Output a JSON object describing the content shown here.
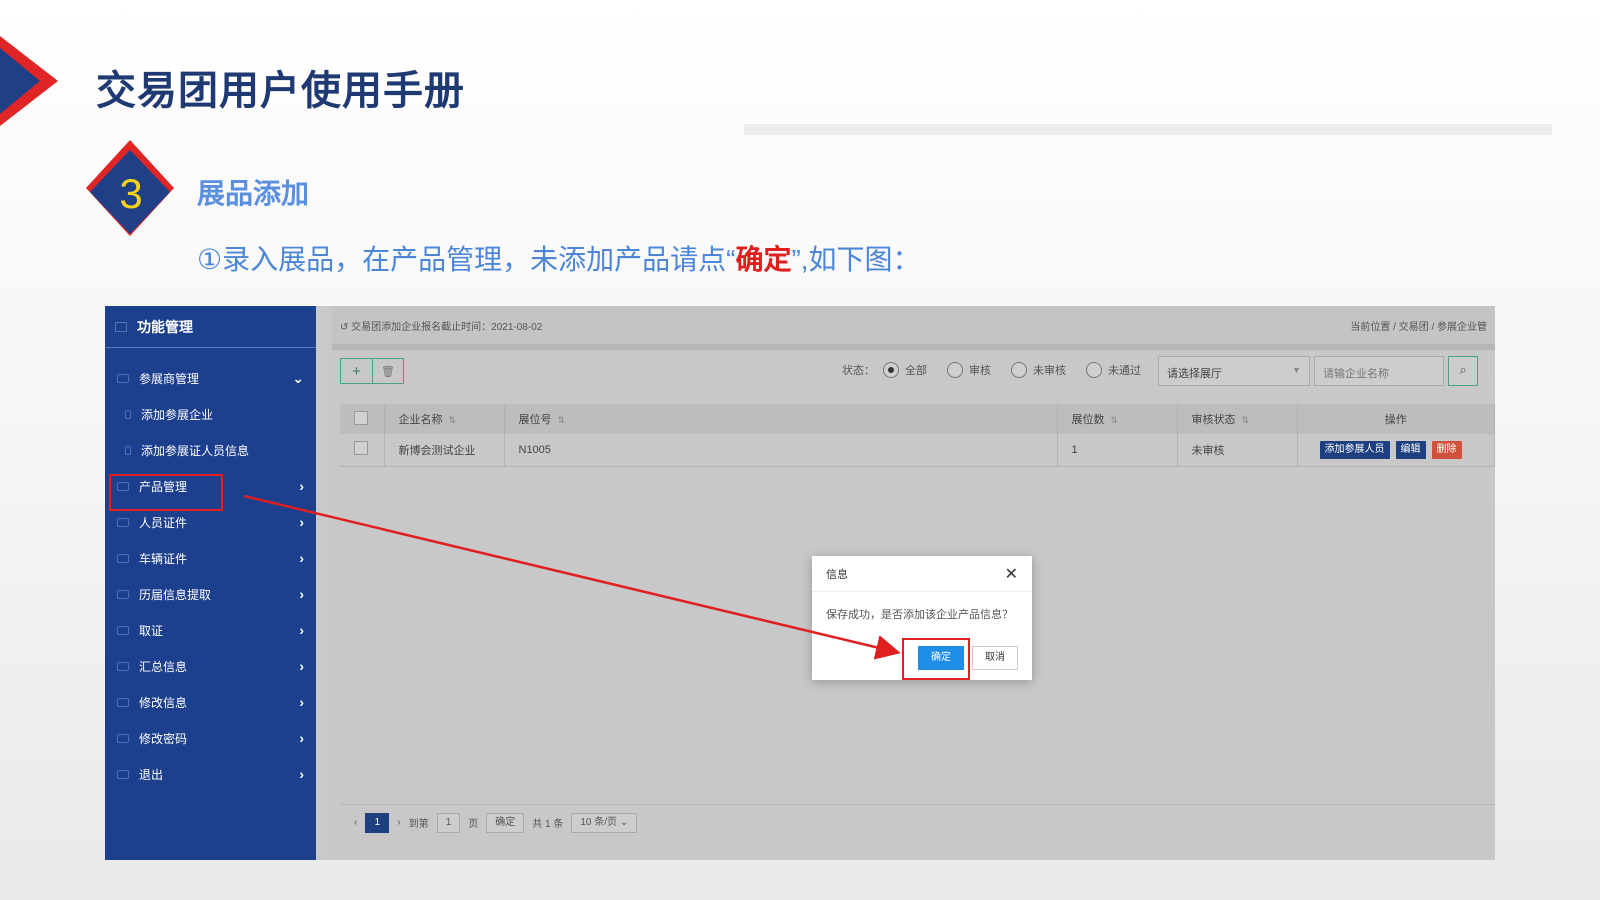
{
  "slide": {
    "title": "交易团用户使用手册",
    "step_number": "3",
    "section_title": "展品添加",
    "instruction_prefix": "①录入展品，在产品管理，未添加产品请点“",
    "instruction_highlight": "确定",
    "instruction_suffix": "”,如下图：",
    "colors": {
      "title": "#1f3a72",
      "accent_red": "#e01e1e",
      "section_blue": "#5b8fe0"
    }
  },
  "app": {
    "sidebar": {
      "header": "功能管理",
      "items": [
        {
          "label": "参展商管理",
          "icon": "list-icon",
          "expanded": true
        },
        {
          "label": "添加参展企业",
          "icon": "list-icon",
          "sub": true
        },
        {
          "label": "添加参展证人员信息",
          "icon": "list-icon",
          "sub": true
        },
        {
          "label": "产品管理",
          "icon": "monitor-icon",
          "selected": true
        },
        {
          "label": "人员证件",
          "icon": "id-card-icon"
        },
        {
          "label": "车辆证件",
          "icon": "car-icon"
        },
        {
          "label": "历届信息提取",
          "icon": "history-icon"
        },
        {
          "label": "取证",
          "icon": "id-card-icon"
        },
        {
          "label": "汇总信息",
          "icon": "chart-icon"
        },
        {
          "label": "修改信息",
          "icon": "gear-icon"
        },
        {
          "label": "修改密码",
          "icon": "lock-icon"
        },
        {
          "label": "退出",
          "icon": "power-icon"
        }
      ]
    },
    "topbar": {
      "deadline": "交易团添加企业报名截止时间：2021-08-02",
      "breadcrumb": "当前位置 / 交易团 / 参展企业管"
    },
    "filter": {
      "status_label": "状态：",
      "options": [
        "全部",
        "审核",
        "未审核",
        "未通过"
      ],
      "selected": "全部",
      "hall_placeholder": "请选择展厅",
      "company_placeholder": "请输企业名称"
    },
    "table": {
      "columns": [
        "企业名称",
        "展位号",
        "展位数",
        "审核状态",
        "操作"
      ],
      "rows": [
        {
          "company": "新博会测试企业",
          "booth": "N1005",
          "booth_count": "1",
          "status": "未审核"
        }
      ],
      "actions": [
        "添加参展人员",
        "编辑",
        "删除"
      ]
    },
    "pager": {
      "current": "1",
      "goto_label": "到第",
      "page_input": "1",
      "page_unit": "页",
      "confirm": "确定",
      "total": "共 1 条",
      "page_size": "10 条/页"
    },
    "dialog": {
      "title": "信息",
      "message": "保存成功，是否添加该企业产品信息？",
      "ok": "确定",
      "cancel": "取消"
    }
  }
}
